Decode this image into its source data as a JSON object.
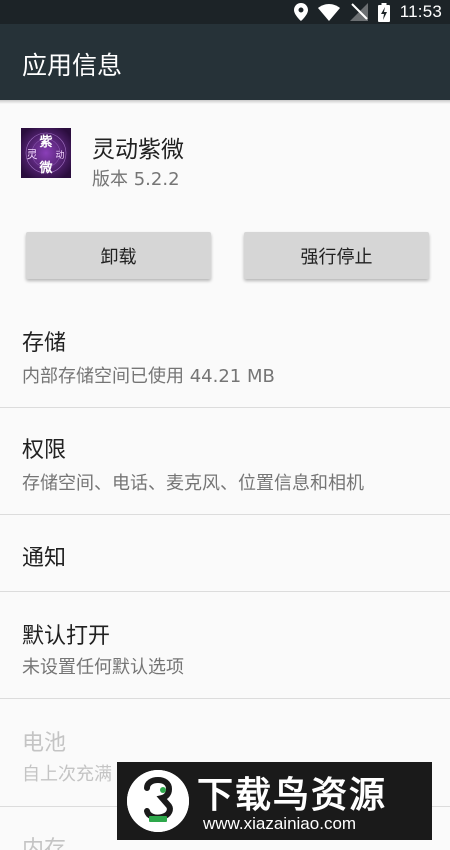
{
  "status_bar": {
    "time": "11:53",
    "icons": [
      "location-icon",
      "wifi-icon",
      "no-signal-icon",
      "battery-charging-icon"
    ]
  },
  "app_bar": {
    "title": "应用信息"
  },
  "app": {
    "name": "灵动紫微",
    "version": "版本 5.2.2",
    "icon_text": "紫灵微动"
  },
  "buttons": {
    "uninstall": "卸载",
    "force_stop": "强行停止"
  },
  "rows": [
    {
      "title": "存储",
      "subtitle": "内部存储空间已使用 44.21 MB",
      "enabled": true
    },
    {
      "title": "权限",
      "subtitle": "存储空间、电话、麦克风、位置信息和相机",
      "enabled": true
    },
    {
      "title": "通知",
      "subtitle": "",
      "enabled": true
    },
    {
      "title": "默认打开",
      "subtitle": "未设置任何默认选项",
      "enabled": true
    },
    {
      "title": "电池",
      "subtitle": "自上次充满",
      "enabled": false
    },
    {
      "title": "内存",
      "subtitle": "",
      "enabled": false
    }
  ],
  "watermark": {
    "title": "下载鸟资源",
    "url": "www.xiazainiao.com"
  },
  "colors": {
    "app_bar": "#263238",
    "status_bar": "#1c2327",
    "button": "#d6d6d6",
    "app_icon": "#4a1a64"
  }
}
